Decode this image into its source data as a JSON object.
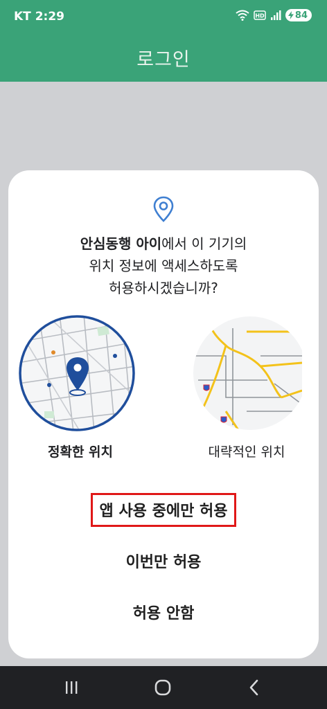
{
  "status_bar": {
    "carrier_time": "KT 2:29",
    "battery_level": "84",
    "icons": [
      "wifi-icon",
      "hd-icon",
      "signal-icon",
      "battery-charging-icon"
    ]
  },
  "app_bar": {
    "title": "로그인"
  },
  "dialog": {
    "icon": "location-pin-icon",
    "message_app_name": "안심동행 아이",
    "message_line1_rest": "에서 이 기기의",
    "message_line2": "위치 정보에 액세스하도록",
    "message_line3": "허용하시겠습니까?",
    "precise_label": "정확한 위치",
    "approximate_label": "대략적인 위치",
    "buttons": {
      "while_using": "앱 사용 중에만 허용",
      "only_this_time": "이번만 허용",
      "deny": "허용 안함"
    }
  },
  "nav_bar": {
    "icons": [
      "recent-apps-icon",
      "home-icon",
      "back-icon"
    ]
  },
  "colors": {
    "accent": "#3aa378",
    "highlight_border": "#e01818",
    "map_blue": "#1f4e9c",
    "road_yellow": "#f3c21a"
  }
}
